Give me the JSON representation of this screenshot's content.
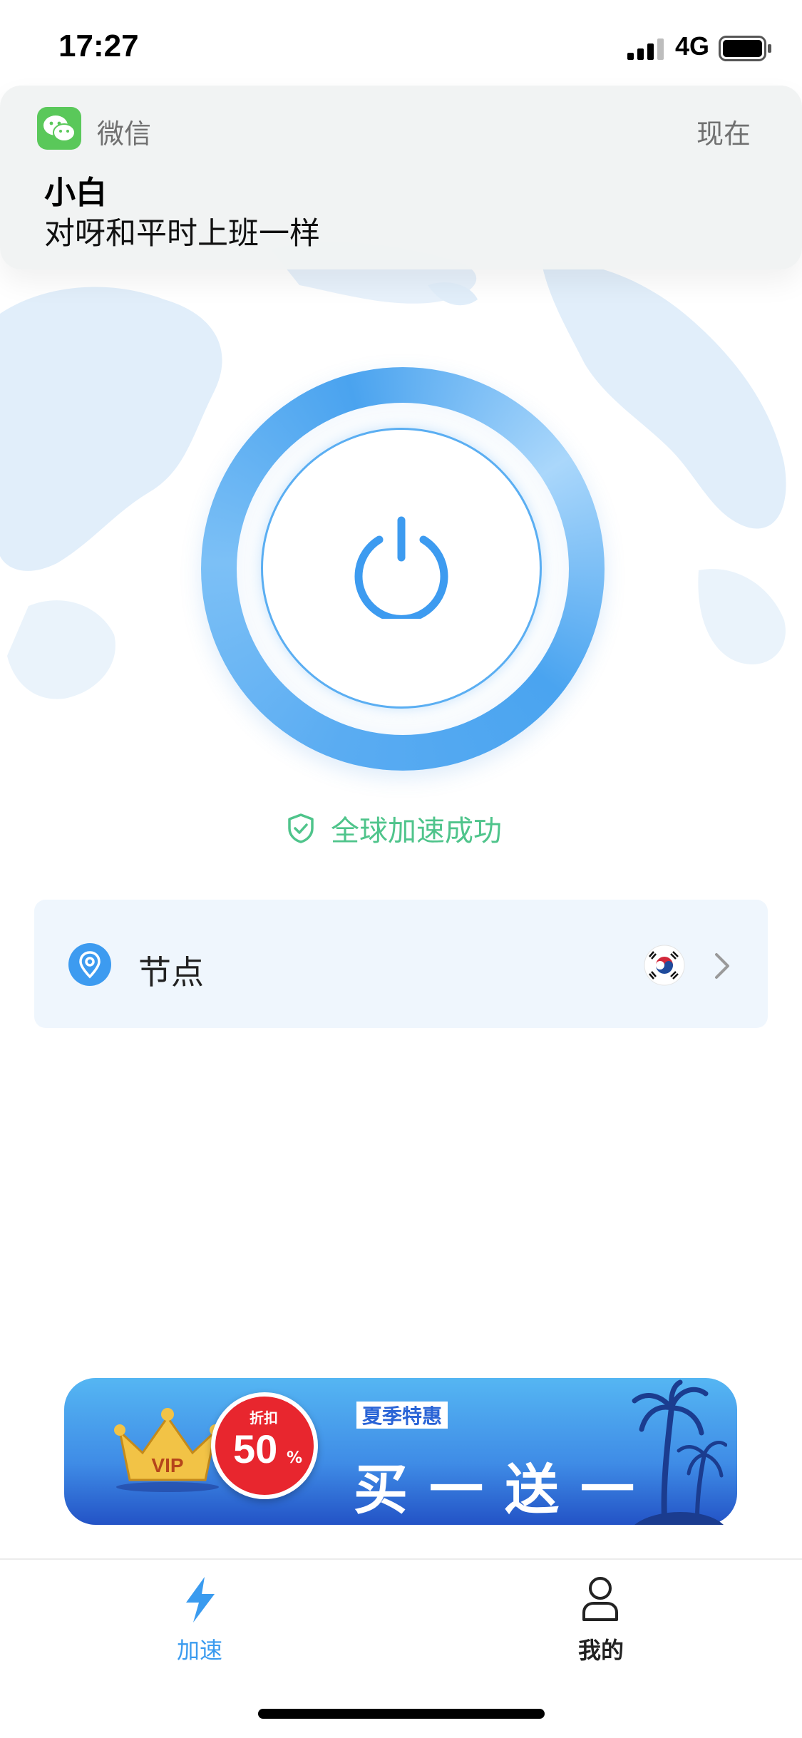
{
  "status_bar": {
    "time": "17:27",
    "network": "4G"
  },
  "notification": {
    "app_name": "微信",
    "time": "现在",
    "sender": "小白",
    "message": "对呀和平时上班一样"
  },
  "connection": {
    "status_text": "全球加速成功"
  },
  "node": {
    "label": "节点",
    "flag": "south-korea-flag-icon"
  },
  "promo": {
    "discount_label": "折扣",
    "discount_value": "50",
    "discount_unit": "%",
    "crown_text": "VIP",
    "tag": "夏季特惠",
    "title": "买一送一"
  },
  "tabs": [
    {
      "label": "加速",
      "icon": "lightning-icon",
      "active": true
    },
    {
      "label": "我的",
      "icon": "person-icon",
      "active": false
    }
  ],
  "colors": {
    "accent": "#3a9bef",
    "success": "#4fc48b",
    "card_bg": "#eff6fd",
    "wechat_green": "#5ac85a"
  }
}
